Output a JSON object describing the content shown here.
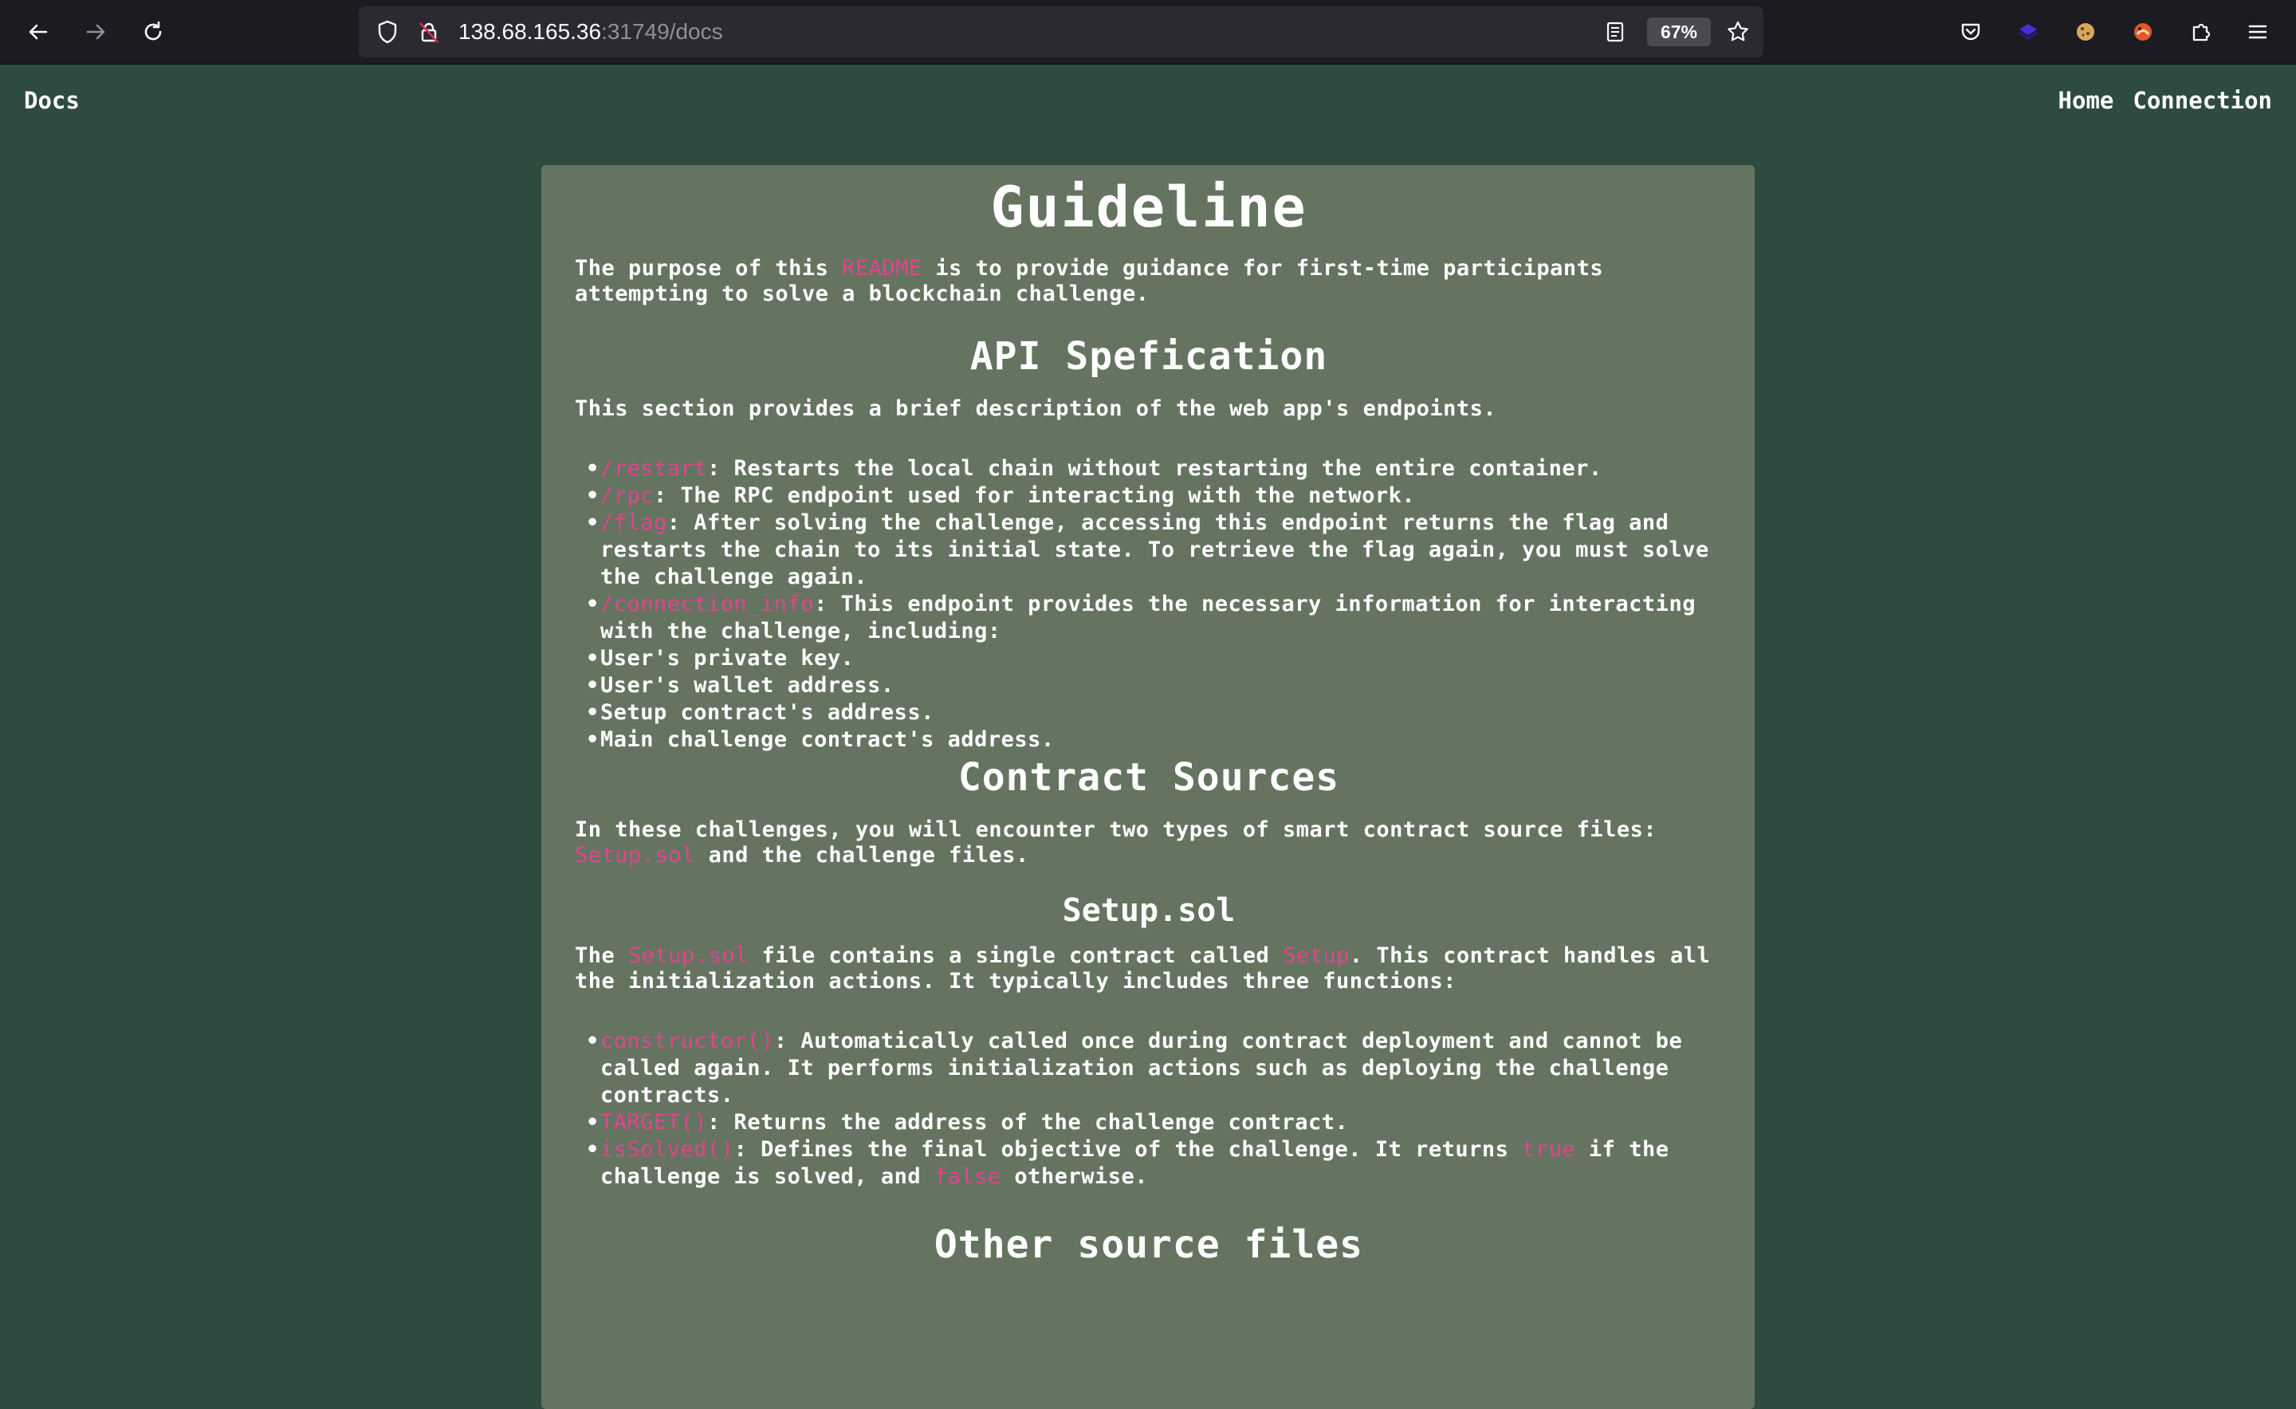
{
  "browser": {
    "url_host": "138.68.165.36",
    "url_rest": ":31749/docs",
    "zoom": "67%",
    "icons": [
      "back-arrow-icon",
      "forward-arrow-icon",
      "reload-icon",
      "shield-icon",
      "insecure-lock-icon",
      "reader-view-icon",
      "bookmark-star-icon",
      "pocket-icon",
      "extension-purple-icon",
      "cookie-icon",
      "extension-orange-icon",
      "extensions-puzzle-icon",
      "menu-icon"
    ]
  },
  "site": {
    "title": "Docs",
    "nav": [
      "Home",
      "Connection"
    ]
  },
  "doc": {
    "h_guideline": "Guideline",
    "intro": [
      "The purpose of this ",
      "README",
      " is to provide guidance for first-time participants attempting to solve a blockchain challenge."
    ],
    "h_api": "API Spefication",
    "api_intro": "This section provides a brief description of the web app's endpoints.",
    "endpoints": [
      {
        "code": "/restart",
        "text": ": Restarts the local chain without restarting the entire container."
      },
      {
        "code": "/rpc",
        "text": ": The RPC endpoint used for interacting with the network."
      },
      {
        "code": "/flag",
        "text": ": After solving the challenge, accessing this endpoint returns the flag and restarts the chain to its initial state. To retrieve the flag again, you must solve the challenge again."
      },
      {
        "code": "/connection_info",
        "text": ": This endpoint provides the necessary information for interacting with the challenge, including:"
      }
    ],
    "info_items": [
      "User's private key.",
      "User's wallet address.",
      "Setup contract's address.",
      "Main challenge contract's address."
    ],
    "h_sources": "Contract Sources",
    "sources_intro": [
      "In these challenges, you will encounter two types of smart contract source files: ",
      "Setup.sol",
      " and the challenge files."
    ],
    "h_setup": "Setup.sol",
    "setup_intro": [
      "The ",
      "Setup.sol",
      " file contains a single contract called ",
      "Setup",
      ". This contract handles all the initialization actions. It typically includes three functions:"
    ],
    "functions": [
      {
        "code": "constructor()",
        "text": ": Automatically called once during contract deployment and cannot be called again. It performs initialization actions such as deploying the challenge contracts."
      },
      {
        "code": "TARGET()",
        "text": ": Returns the address of the challenge contract."
      },
      {
        "code": "isSolved()",
        "parts": [
          ": Defines the final objective of the challenge. It returns ",
          "true",
          " if the challenge is solved, and ",
          "false",
          " otherwise."
        ]
      }
    ],
    "h_other": "Other source files"
  }
}
